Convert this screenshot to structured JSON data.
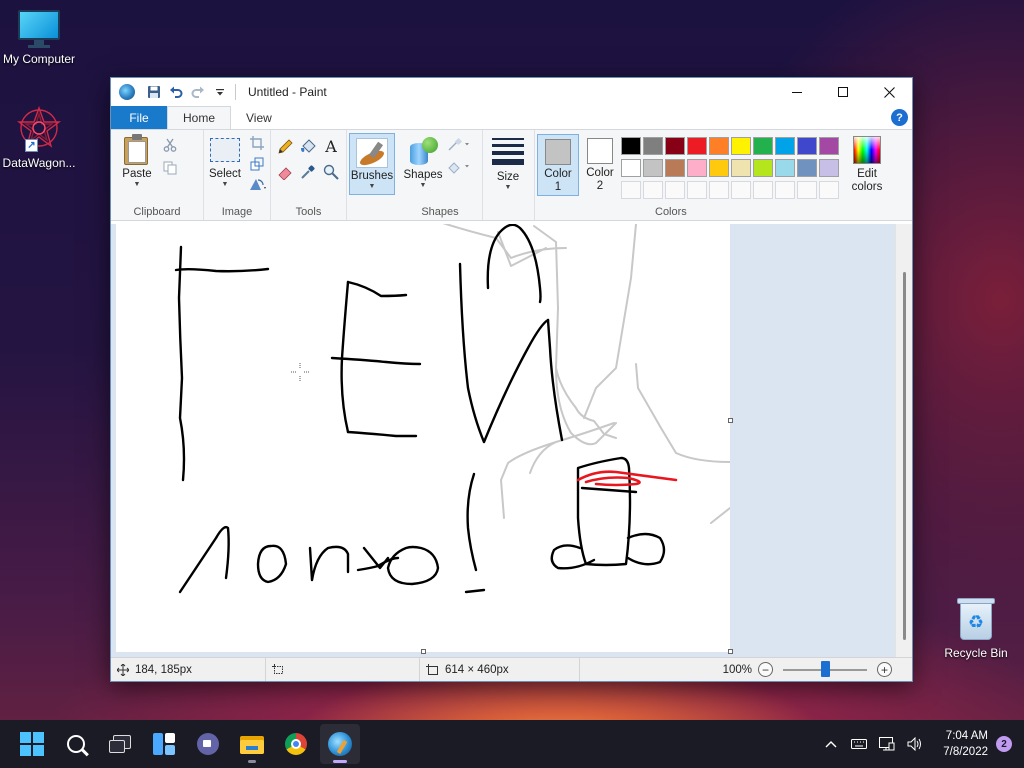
{
  "desktop": {
    "icons": [
      {
        "label": "My Computer"
      },
      {
        "label": "DataWagon..."
      },
      {
        "label": "Recycle Bin"
      }
    ]
  },
  "window": {
    "title": "Untitled - Paint",
    "controls": {
      "minimize": "—",
      "maximize": "☐",
      "close": "✕"
    }
  },
  "ribbon": {
    "tabs": [
      {
        "label": "File"
      },
      {
        "label": "Home",
        "active": true
      },
      {
        "label": "View"
      }
    ],
    "help": "?",
    "groups": {
      "clipboard": {
        "name": "Clipboard",
        "paste": "Paste"
      },
      "image": {
        "name": "Image",
        "select": "Select"
      },
      "tools": {
        "name": "Tools"
      },
      "brushes": {
        "label": "Brushes"
      },
      "shapes": {
        "name": "Shapes",
        "label": "Shapes"
      },
      "size": {
        "label": "Size"
      },
      "colors": {
        "name": "Colors",
        "color1": {
          "label": "Color",
          "num": "1",
          "value": "#c3c3c3"
        },
        "color2": {
          "label": "Color",
          "num": "2",
          "value": "#ffffff"
        },
        "edit_line1": "Edit",
        "edit_line2": "colors",
        "palette_row1": [
          "#000000",
          "#7f7f7f",
          "#880015",
          "#ed1c24",
          "#ff7f27",
          "#fff200",
          "#22b14c",
          "#00a2e8",
          "#3f48cc",
          "#a349a4"
        ],
        "palette_row2": [
          "#ffffff",
          "#c3c3c3",
          "#b97a57",
          "#ffaec9",
          "#ffc90e",
          "#efe4b0",
          "#b5e61d",
          "#99d9ea",
          "#7092be",
          "#c8bfe7"
        ]
      }
    }
  },
  "canvas": {
    "drawing_colors": {
      "ink": "#000000",
      "red": "#e8161f",
      "faint": "#c8c8c8"
    }
  },
  "statusbar": {
    "cursor_pos": "184, 185px",
    "selection_size": "",
    "image_size": "614 × 460px",
    "zoom": "100%",
    "zoom_level": 0.5
  },
  "taskbar": {
    "apps": [
      "start-button",
      "search",
      "task-view",
      "widgets",
      "chat",
      "file-explorer",
      "chrome",
      "paint"
    ],
    "clock_time": "7:04 AM",
    "clock_date": "7/8/2022",
    "notifications": "2"
  }
}
